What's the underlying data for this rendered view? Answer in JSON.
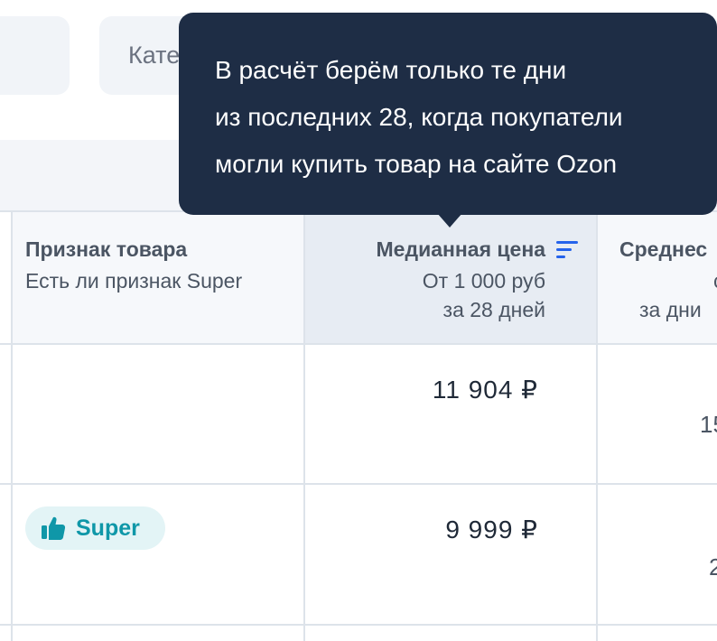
{
  "filters": {
    "category_label": "Кате"
  },
  "tooltip": {
    "lines": [
      "В расчёт берём только те дни",
      "из последних 28, когда покупатели",
      "могли купить товар на сайте Ozon"
    ]
  },
  "table": {
    "columns": [
      {
        "title": "Признак товара",
        "subtitle": "Есть ли признак Super"
      },
      {
        "title": "Медианная цена",
        "subtitle_1": "От 1 000 руб",
        "subtitle_2": "за 28 дней",
        "sorted": true
      },
      {
        "title": "Среднес",
        "subtitle_1": "с",
        "subtitle_2": "за дни"
      }
    ],
    "rows": [
      {
        "badge": "",
        "median_price": "11 904 ₽",
        "third": "15"
      },
      {
        "badge": "Super",
        "median_price": "9 999 ₽",
        "third": "2"
      }
    ]
  },
  "colors": {
    "tooltip_bg": "#1e2d45",
    "accent": "#2563eb",
    "badge_text": "#0f97a8"
  }
}
